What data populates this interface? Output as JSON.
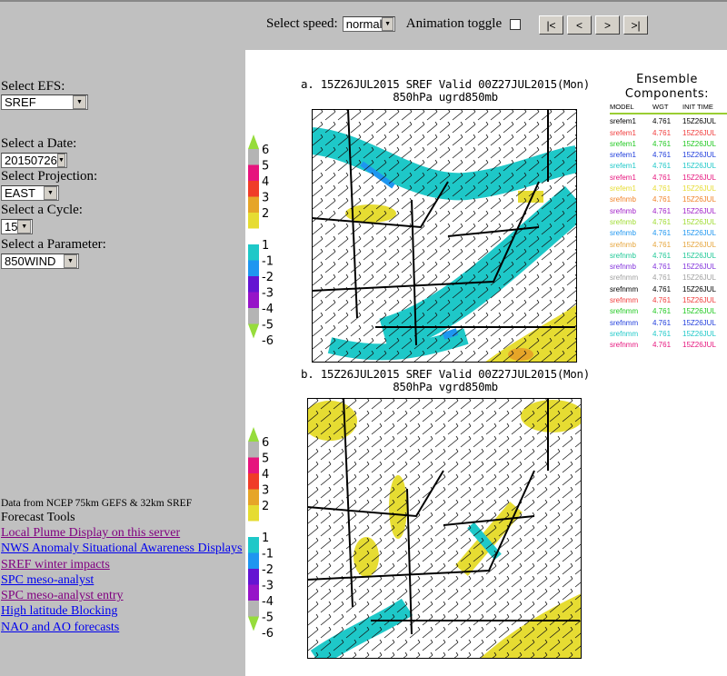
{
  "controls": {
    "speed_label": "Select speed:",
    "speed_value": "normal",
    "animation_label": "Animation toggle",
    "animation_checked": false,
    "nav_buttons": [
      "|<",
      "<",
      ">",
      ">|"
    ]
  },
  "sidebar": {
    "efs_label": "Select EFS:",
    "efs_value": "SREF",
    "date_label": "Select a Date:",
    "date_value": "20150726",
    "projection_label": "Select Projection:",
    "projection_value": "EAST",
    "cycle_label": "Select a Cycle:",
    "cycle_value": "15",
    "parameter_label": "Select a Parameter:",
    "parameter_value": "850WIND",
    "data_note": "Data from NCEP 75km GEFS & 32km SREF",
    "tools_heading": "Forecast Tools",
    "links": [
      {
        "label": "Local Plume Display on this server",
        "visited": true
      },
      {
        "label": "NWS Anomaly Situational Awareness Displays",
        "visited": false
      },
      {
        "label": "SREF winter impacts",
        "visited": true
      },
      {
        "label": "SPC meso-analyst",
        "visited": false
      },
      {
        "label": "SPC meso-analyst entry",
        "visited": true
      },
      {
        "label": "High latitude Blocking",
        "visited": false
      },
      {
        "label": "NAO and AO forecasts",
        "visited": false
      }
    ]
  },
  "maps": [
    {
      "title": "a. 15Z26JUL2015 SREF Valid 00Z27JUL2015(Mon)",
      "subtitle": "850hPa ugrd850mb"
    },
    {
      "title": "b. 15Z26JUL2015 SREF Valid 00Z27JUL2015(Mon)",
      "subtitle": "850hPa vgrd850mb"
    }
  ],
  "colorbar": {
    "labels": [
      "6",
      "5",
      "4",
      "3",
      "2",
      "1",
      "-1",
      "-2",
      "-3",
      "-4",
      "-5",
      "-6"
    ],
    "colors": [
      "#b4b4b4",
      "#e6147d",
      "#f03c28",
      "#e6a528",
      "#e6dc32",
      "#ffffff",
      "#1ec8c8",
      "#1e96f0",
      "#6414d2",
      "#9614c8",
      "#b4b4b4"
    ],
    "arrow_color": "#96dc3c"
  },
  "ensemble": {
    "title1": "Ensemble",
    "title2": "Components:",
    "headers": [
      "MODEL",
      "WGT",
      "INIT TIME"
    ],
    "rows": [
      {
        "model": "srefem1",
        "wgt": "4.761",
        "init": "15Z26JUL",
        "color": "#000000"
      },
      {
        "model": "srefem1",
        "wgt": "4.761",
        "init": "15Z26JUL",
        "color": "#f03c3c"
      },
      {
        "model": "srefem1",
        "wgt": "4.761",
        "init": "15Z26JUL",
        "color": "#1ec81e"
      },
      {
        "model": "srefem1",
        "wgt": "4.761",
        "init": "15Z26JUL",
        "color": "#1e3cdc"
      },
      {
        "model": "srefem1",
        "wgt": "4.761",
        "init": "15Z26JUL",
        "color": "#1ec8c8"
      },
      {
        "model": "srefem1",
        "wgt": "4.761",
        "init": "15Z26JUL",
        "color": "#e6147d"
      },
      {
        "model": "srefem1",
        "wgt": "4.761",
        "init": "15Z26JUL",
        "color": "#e6dc32"
      },
      {
        "model": "srefnmb",
        "wgt": "4.761",
        "init": "15Z26JUL",
        "color": "#f08228"
      },
      {
        "model": "srefnmb",
        "wgt": "4.761",
        "init": "15Z26JUL",
        "color": "#a01ec8"
      },
      {
        "model": "srefnmb",
        "wgt": "4.761",
        "init": "15Z26JUL",
        "color": "#a0dc32"
      },
      {
        "model": "srefnmb",
        "wgt": "4.761",
        "init": "15Z26JUL",
        "color": "#1e96f0"
      },
      {
        "model": "srefnmb",
        "wgt": "4.761",
        "init": "15Z26JUL",
        "color": "#e6a53c"
      },
      {
        "model": "srefnmb",
        "wgt": "4.761",
        "init": "15Z26JUL",
        "color": "#1ec896"
      },
      {
        "model": "srefnmb",
        "wgt": "4.761",
        "init": "15Z26JUL",
        "color": "#8232dc"
      },
      {
        "model": "srefnmm",
        "wgt": "4.761",
        "init": "15Z26JUL",
        "color": "#a0a0a0"
      },
      {
        "model": "srefnmm",
        "wgt": "4.761",
        "init": "15Z26JUL",
        "color": "#000000"
      },
      {
        "model": "srefnmm",
        "wgt": "4.761",
        "init": "15Z26JUL",
        "color": "#f03c3c"
      },
      {
        "model": "srefnmm",
        "wgt": "4.761",
        "init": "15Z26JUL",
        "color": "#1ec81e"
      },
      {
        "model": "srefnmm",
        "wgt": "4.761",
        "init": "15Z26JUL",
        "color": "#1e3cdc"
      },
      {
        "model": "srefnmm",
        "wgt": "4.761",
        "init": "15Z26JUL",
        "color": "#1ec8c8"
      },
      {
        "model": "srefnmm",
        "wgt": "4.761",
        "init": "15Z26JUL",
        "color": "#e6147d"
      }
    ]
  }
}
